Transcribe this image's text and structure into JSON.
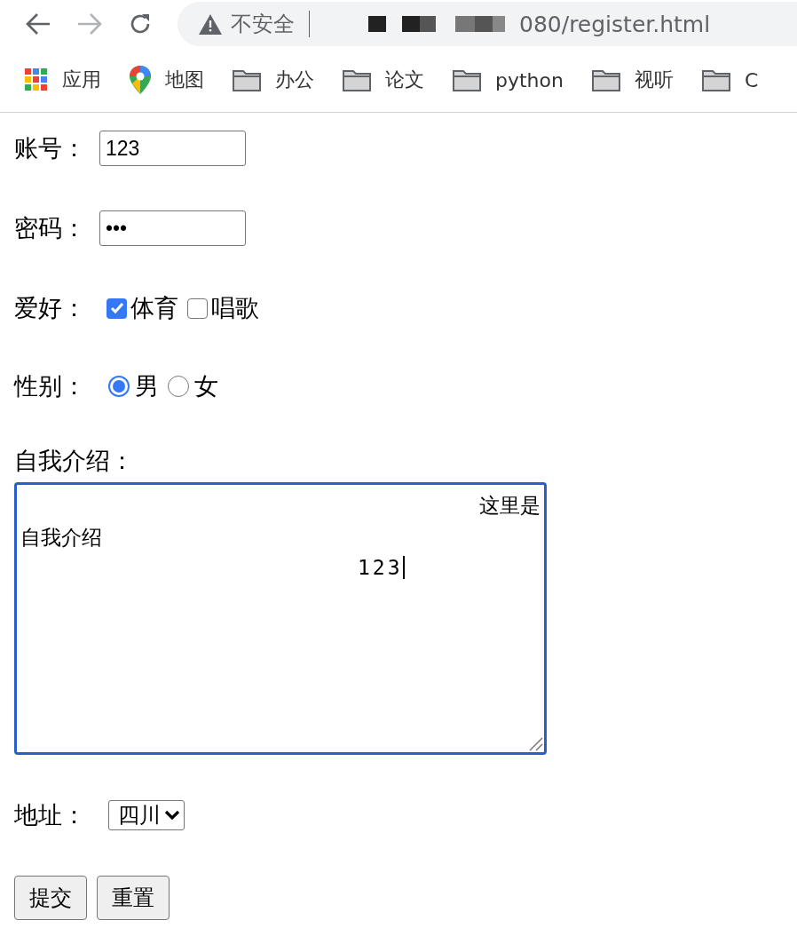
{
  "toolbar": {
    "back_disabled": false,
    "forward_disabled": true,
    "security": "不安全",
    "url": "080/register.html"
  },
  "bookmarks": [
    {
      "kind": "apps",
      "label": "应用"
    },
    {
      "kind": "map",
      "label": "地图"
    },
    {
      "kind": "folder",
      "label": "办公"
    },
    {
      "kind": "folder",
      "label": "论文"
    },
    {
      "kind": "folder",
      "label": "python"
    },
    {
      "kind": "folder",
      "label": "视听"
    },
    {
      "kind": "folder",
      "label": "C"
    }
  ],
  "form": {
    "account": {
      "label": "账号：",
      "value": "123"
    },
    "password": {
      "label": "密码：",
      "value": "•••"
    },
    "hobbies": {
      "label": "爱好：",
      "options": [
        {
          "label": "体育",
          "checked": true
        },
        {
          "label": "唱歌",
          "checked": false
        }
      ]
    },
    "gender": {
      "label": "性别：",
      "options": [
        {
          "label": "男",
          "selected": true
        },
        {
          "label": "女",
          "selected": false
        }
      ]
    },
    "intro": {
      "label": "自我介绍：",
      "lines": [
        "这里是",
        "自我介绍",
        "123"
      ],
      "focused": true
    },
    "address": {
      "label": "地址：",
      "value": "四川"
    },
    "buttons": [
      "提交",
      "重置"
    ]
  }
}
